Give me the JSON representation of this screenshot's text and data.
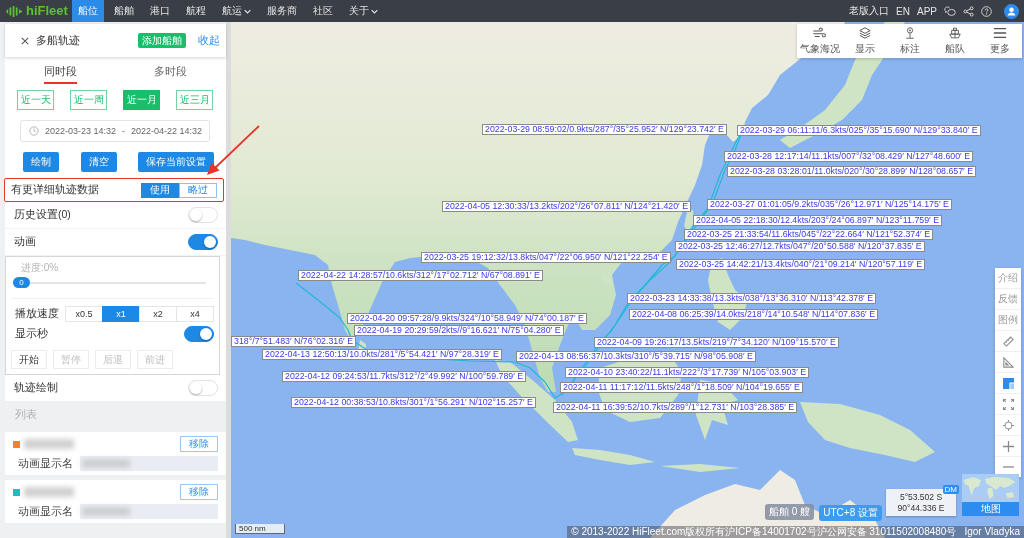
{
  "nav": {
    "logo": "hiFleet",
    "items": [
      {
        "label": "船位",
        "selected": true,
        "dropdown": false
      },
      {
        "label": "船舶",
        "selected": false,
        "dropdown": false
      },
      {
        "label": "港口",
        "selected": false,
        "dropdown": false
      },
      {
        "label": "航程",
        "selected": false,
        "dropdown": false
      },
      {
        "label": "航运",
        "selected": false,
        "dropdown": true
      },
      {
        "label": "服务商",
        "selected": false,
        "dropdown": false
      },
      {
        "label": "社区",
        "selected": false,
        "dropdown": false
      },
      {
        "label": "关于",
        "selected": false,
        "dropdown": true
      }
    ],
    "links": [
      "老版入口",
      "EN",
      "APP"
    ]
  },
  "panel": {
    "title": "多船轨迹",
    "add_button": "添加船舶",
    "collapse": "收起",
    "tabs": [
      {
        "label": "同时段",
        "selected": true
      },
      {
        "label": "多时段",
        "selected": false
      }
    ],
    "ranges": [
      {
        "label": "近一天",
        "selected": false
      },
      {
        "label": "近一周",
        "selected": false
      },
      {
        "label": "近一月",
        "selected": true
      },
      {
        "label": "近三月",
        "selected": false
      }
    ],
    "date_range": {
      "start": "2022-03-23 14:32",
      "separator": "-",
      "end": "2022-04-22 14:32"
    },
    "actions": [
      "绘制",
      "清空",
      "保存当前设置"
    ],
    "detail_notice": {
      "label": "有更详细轨迹数据",
      "highlighted": true,
      "options": [
        {
          "label": "使用",
          "selected": true
        },
        {
          "label": "略过",
          "selected": false
        }
      ]
    },
    "switches": [
      {
        "label": "历史设置(0)",
        "on": false
      },
      {
        "label": "动画",
        "on": true
      }
    ],
    "animation": {
      "progress_label": "进度:0%",
      "progress": {
        "value": "0",
        "level": 0
      },
      "speed_label": "播放速度",
      "speeds": [
        {
          "label": "x0.5",
          "selected": false
        },
        {
          "label": "x1",
          "selected": true
        },
        {
          "label": "x2",
          "selected": false
        },
        {
          "label": "x4",
          "selected": false
        }
      ],
      "seconds": {
        "label": "显示秒",
        "on": true
      },
      "controls": [
        {
          "label": "开始",
          "disabled": false
        },
        {
          "label": "暂停",
          "disabled": true
        },
        {
          "label": "后退",
          "disabled": true
        },
        {
          "label": "前进",
          "disabled": true
        }
      ]
    },
    "track_drawing": {
      "label": "轨迹绘制",
      "on": false
    },
    "list_title": "列表",
    "vessels": [
      {
        "color": "#f5812a",
        "remove": "移除",
        "name_label": "动画显示名"
      },
      {
        "color": "#1bbfbf",
        "remove": "移除",
        "name_label": "动画显示名"
      }
    ]
  },
  "map": {
    "toolbar": [
      "气象海况",
      "显示",
      "标注",
      "船队",
      "更多"
    ],
    "side_tools": [
      {
        "kind": "text",
        "label": "介绍",
        "selected": false
      },
      {
        "kind": "text",
        "label": "反馈",
        "selected": false
      },
      {
        "kind": "text",
        "label": "图例",
        "selected": false
      },
      {
        "kind": "icon",
        "selected": false
      },
      {
        "kind": "icon",
        "selected": false
      },
      {
        "kind": "icon",
        "selected": true
      },
      {
        "kind": "icon",
        "selected": false
      },
      {
        "kind": "icon",
        "selected": false
      },
      {
        "kind": "icon",
        "selected": false
      },
      {
        "kind": "icon",
        "selected": false
      }
    ],
    "track_labels": [
      "2022-03-29 08:59:02/0.9kts/287°/35°25.952′ N/129°23.742′ E",
      "2022-03-29 06:11:11/6.3kts/025°/35°15.690′ N/129°33.840′ E",
      "2022-03-28 12:17:14/11.1kts/007°/32°08.429′ N/127°48.600′ E",
      "2022-03-28 03:28:01/11.0kts/020°/30°28.899′ N/128°08.657′ E",
      "2022-04-05 12:30:33/13.2kts/202°/26°07.811′ N/124°21.420′ E",
      "2022-03-27 01:01:05/9.2kts/035°/26°12.971′ N/125°14.175′ E",
      "2022-04-05 22:18:30/12.4kts/203°/24°06.897′ N/123°11.759′ E",
      "2022-03-25 21:33:54/11.6kts/045°/22°22.664′ N/121°52.374′ E",
      "2022-03-25 12:46:27/12.7kts/047°/20°50.588′ N/120°37.835′ E",
      "2022-03-25 19:12:32/13.8kts/047°/22°06.950′ N/121°22.254′ E",
      "2022-03-25 14:42:21/13.4kts/040°/21°09.214′ N/120°57.119′ E",
      "2022-04-22 14:28:57/10.6kts/312°/17°02.712′ N/67°08.891′ E",
      "2022-03-23 14:33:38/13.3kts/038°/13°36.310′ N/113°42.378′ E",
      "2022-04-20 09:57:28/9.9kts/324°/10°58.949′ N/74°00.187′ E",
      "2022-04-08 06:25:39/14.0kts/218°/14°10.548′ N/114°07.836′ E",
      "2022-04-19 20:29:59/2kts//9°16.621′ N/75°04.280′ E",
      "318°/7°51.483′ N/76°02.316′ E",
      "2022-04-09 19:26:17/13.5kts/219°/7°34.120′ N/109°15.570′ E",
      "2022-04-13 12:50:13/10.0kts/281°/5°54.421′ N/97°28.319′ E",
      "2022-04-13 08:56:37/10.3kts/310°/5°39.715′ N/98°05.908′ E",
      "2022-04-12 09:24:53/11.7kts/312°/2°49.992′ N/100°59.789′ E",
      "2022-04-10 23:40:22/11.1kts/222°/3°17.739′ N/105°03.903′ E",
      "2022-04-11 11:17:12/11.5kts/248°/1°18.509′ N/104°19.655′ E",
      "2022-04-12 00:38:53/10.8kts/301°/1°56.291′ N/102°15.257′ E",
      "2022-04-11 16:39:52/10.7kts/289°/1°12.731′ N/103°28.385′ E"
    ],
    "scale": "500 nm",
    "vessel_count": "船舶 0 艘",
    "timezone": "UTC+8 设置",
    "cursor": {
      "format": "DM",
      "lat": "5°53.502 S",
      "lon": "90°44.336 E"
    },
    "minimap": "地图",
    "copyright": "© 2013-2022 HiFleet.com版权所有沪ICP备14001702号沪公网安备 31011502008480号",
    "attribution": "Igor Vladyka"
  }
}
